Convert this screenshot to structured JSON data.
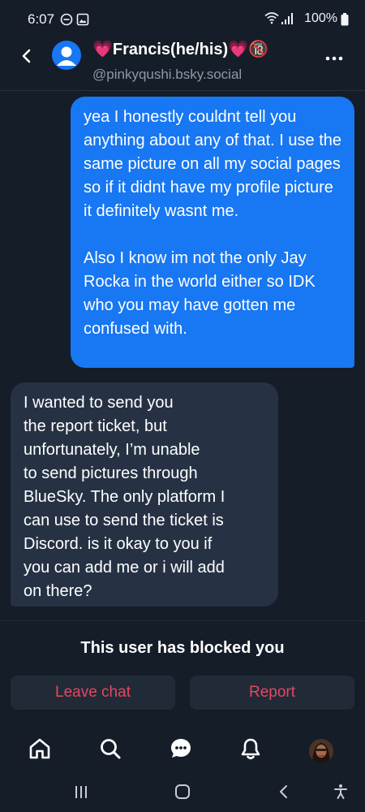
{
  "status_bar": {
    "time": "6:07",
    "battery": "100%"
  },
  "header": {
    "contact_name": "💗Francis(he/his)💗🔞",
    "contact_handle": "@pinkyqushi.bsky.social"
  },
  "messages": [
    {
      "direction": "sent",
      "text": "yea I honestly couldnt tell you anything about any of that. I use the same picture on all my social pages so if it didnt have my profile picture it definitely wasnt me.\n\nAlso I know im not the only Jay Rocka in the world either so IDK who you may have gotten me confused with."
    },
    {
      "direction": "received",
      "text": "I wanted to send you\nthe report ticket, but\nunfortunately, I’m unable\nto send pictures through\nBlueSky. The only platform I\ncan use to send the ticket is\nDiscord. is it okay to you if\nyou can add me or i will add\non there?"
    }
  ],
  "blocked_notice": "This user has blocked you",
  "actions": {
    "leave_label": "Leave chat",
    "report_label": "Report"
  },
  "colors": {
    "background": "#151d28",
    "sent_bubble": "#1877f2",
    "received_bubble": "#263244",
    "danger_text": "#e8465f"
  },
  "bottom_nav": [
    "home-icon",
    "search-icon",
    "chat-icon",
    "notifications-icon",
    "profile-avatar"
  ],
  "system_nav": [
    "recent-apps-icon",
    "home-button-icon",
    "back-icon",
    "accessibility-icon"
  ]
}
